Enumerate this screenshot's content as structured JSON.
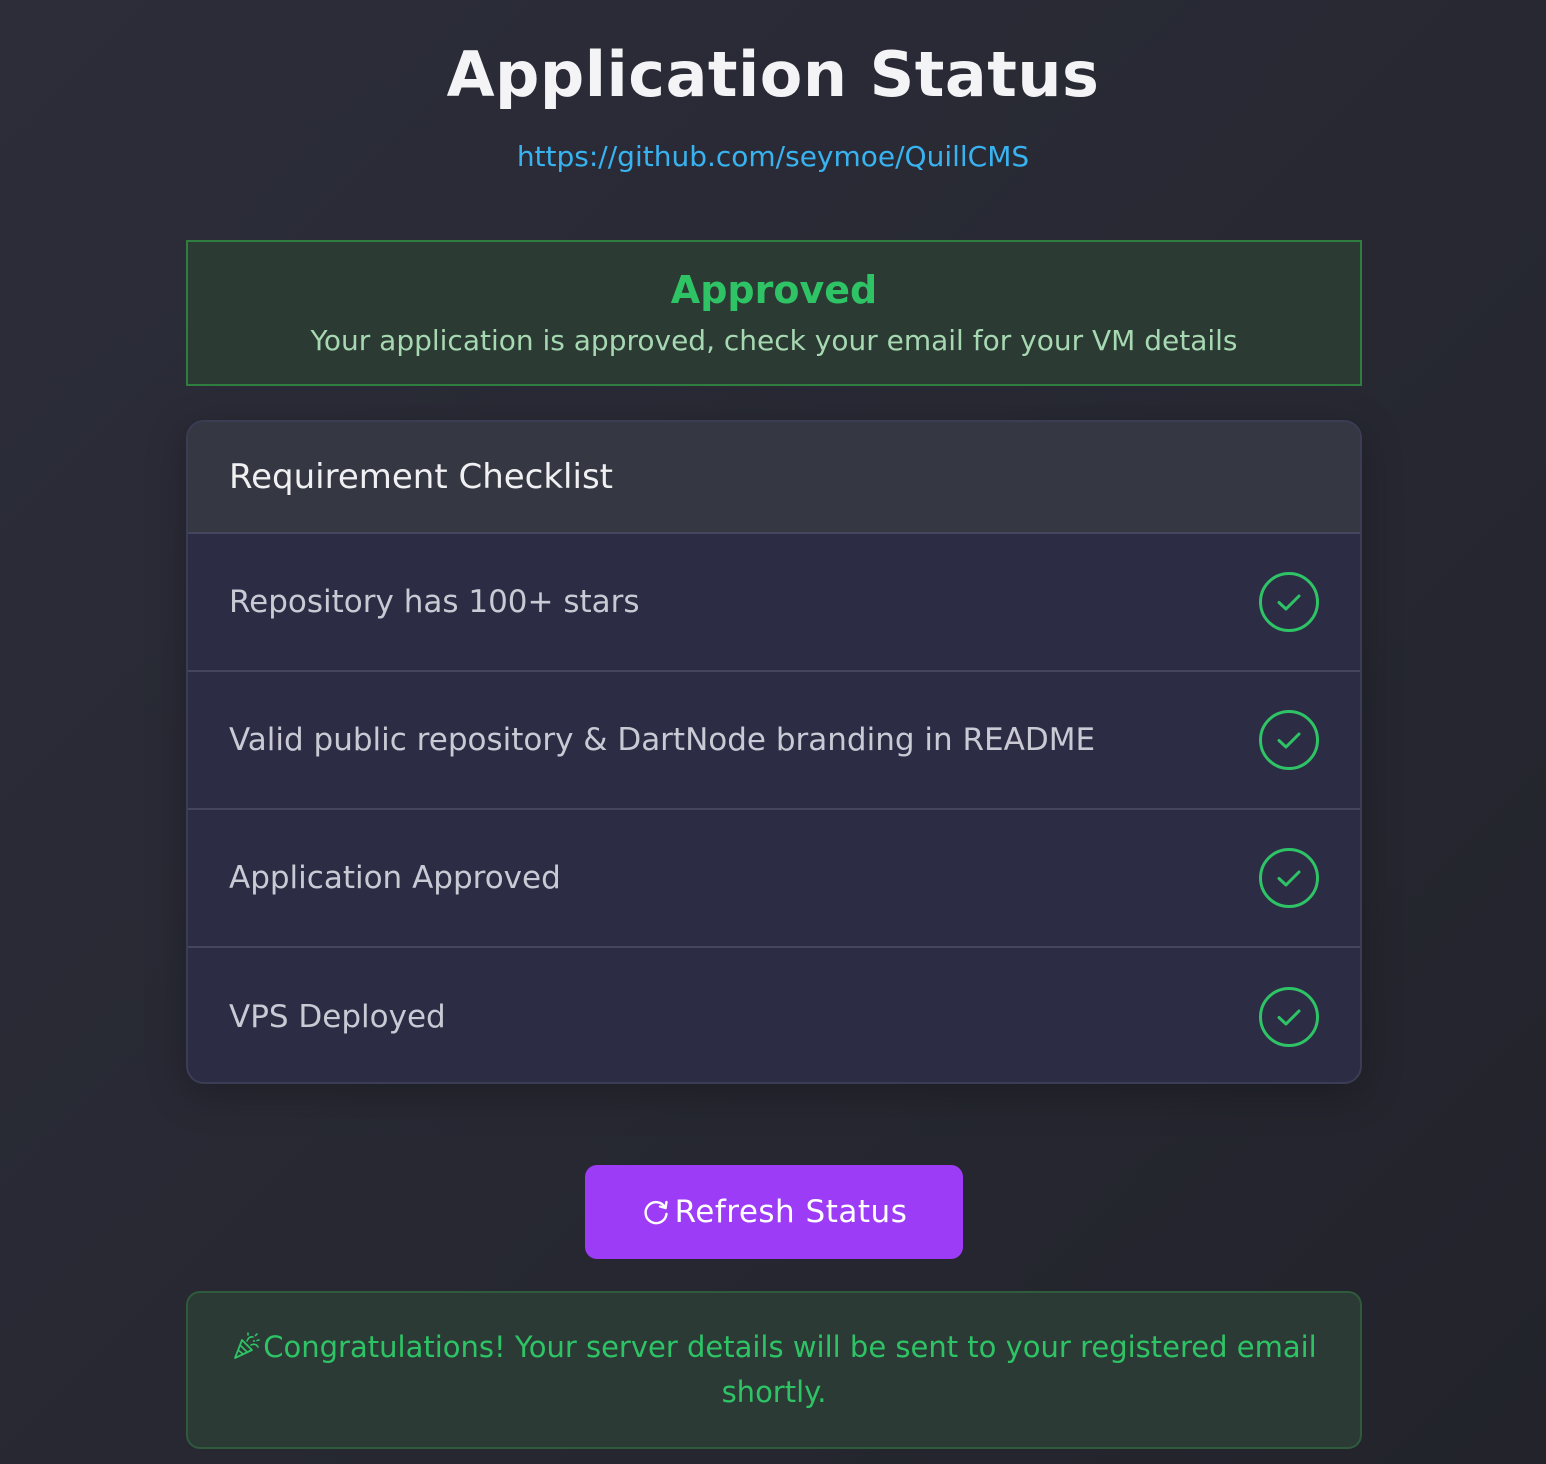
{
  "header": {
    "title": "Application Status",
    "repo_url": "https://github.com/seymoe/QuillCMS"
  },
  "status": {
    "title": "Approved",
    "message": "Your application is approved, check your email for your VM details",
    "color": "#2ec466"
  },
  "checklist": {
    "title": "Requirement Checklist",
    "items": [
      {
        "label": "Repository has 100+ stars",
        "icon": "check-circle-icon",
        "done": true
      },
      {
        "label": "Valid public repository & DartNode branding in README",
        "icon": "check-circle-icon",
        "done": true
      },
      {
        "label": "Application Approved",
        "icon": "check-circle-icon",
        "done": true
      },
      {
        "label": "VPS Deployed",
        "icon": "check-circle-icon",
        "done": true
      }
    ]
  },
  "actions": {
    "refresh_label": "Refresh Status",
    "refresh_icon": "refresh-icon",
    "button_color": "#9d3cf6"
  },
  "congrats": {
    "icon": "party-popper-icon",
    "message": "Congratulations! Your server details will be sent to your registered email shortly."
  }
}
